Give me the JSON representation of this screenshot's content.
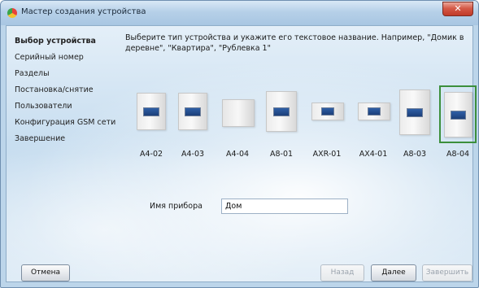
{
  "window": {
    "title": "Мастер создания устройства",
    "close_glyph": "✕"
  },
  "sidebar": {
    "items": [
      {
        "label": "Выбор устройства"
      },
      {
        "label": "Серийный номер"
      },
      {
        "label": "Разделы"
      },
      {
        "label": "Постановка/снятие"
      },
      {
        "label": "Пользователи"
      },
      {
        "label": "Конфигурация GSM сети"
      },
      {
        "label": "Завершение"
      }
    ]
  },
  "main": {
    "instruction": "Выберите тип устройства и укажите его текстовое название. Например, \"Домик в деревне\", \"Квартира\", \"Рублевка 1\"",
    "devices": [
      {
        "label": "A4-02"
      },
      {
        "label": "A4-03"
      },
      {
        "label": "A4-04"
      },
      {
        "label": "A8-01"
      },
      {
        "label": "AXR-01"
      },
      {
        "label": "AX4-01"
      },
      {
        "label": "A8-03"
      },
      {
        "label": "A8-04",
        "selected": true
      }
    ],
    "name_label": "Имя прибора",
    "name_value": "Дом"
  },
  "buttons": {
    "cancel": "Отмена",
    "back": "Назад",
    "next": "Далее",
    "finish": "Завершить"
  },
  "colors": {
    "selection_border": "#3c8f3c",
    "close_button": "#c8453a"
  }
}
